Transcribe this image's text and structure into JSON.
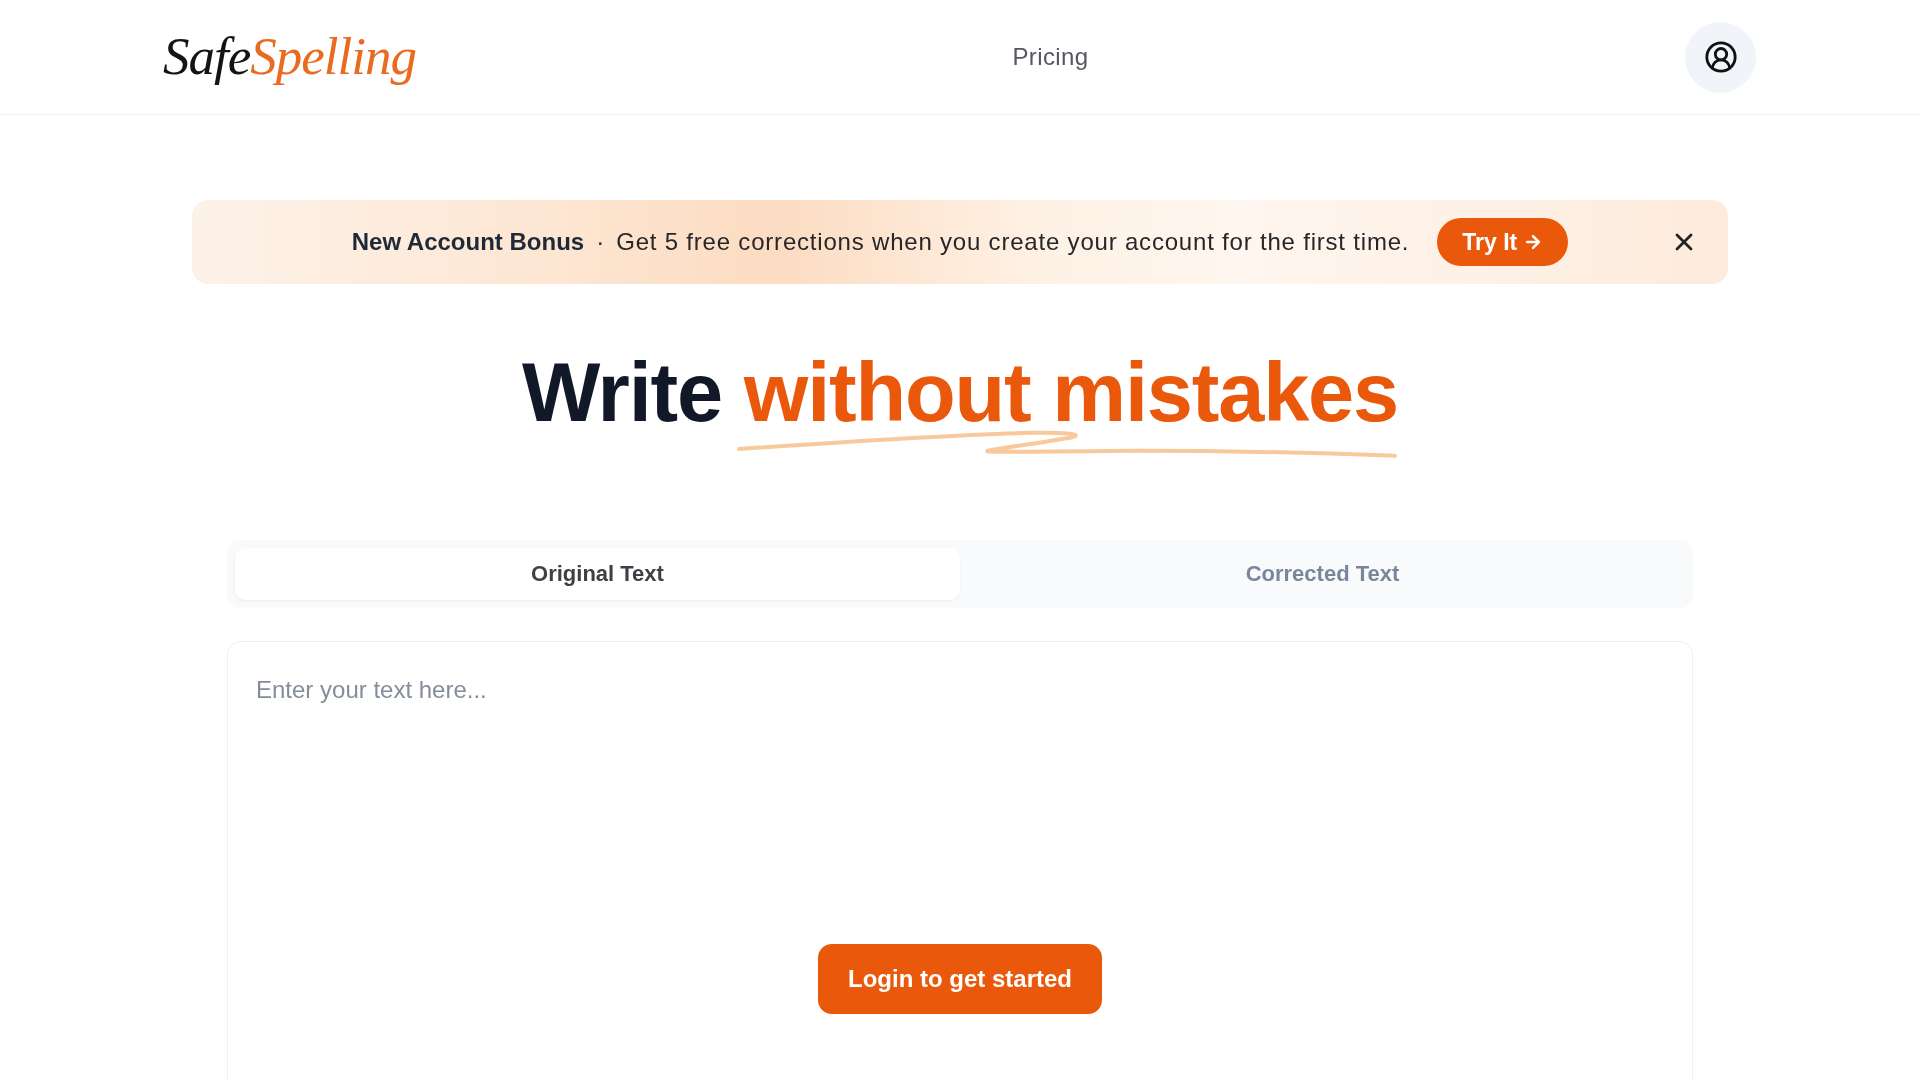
{
  "header": {
    "logo": {
      "first_word": "Safe",
      "second_word": "Spelling"
    },
    "nav": [
      {
        "label": "Pricing"
      }
    ]
  },
  "banner": {
    "title": "New Account Bonus",
    "separator": "·",
    "message": "Get 5 free corrections when you create your account for the first time.",
    "button": "Try It"
  },
  "heading": {
    "text": "Write",
    "highlight": "without mistakes"
  },
  "editor": {
    "tabs": [
      {
        "label": "Original Text",
        "selected": true
      },
      {
        "label": "Corrected Text",
        "selected": false
      }
    ],
    "placeholder": "Enter your text here...",
    "button": "Login to get started"
  }
}
